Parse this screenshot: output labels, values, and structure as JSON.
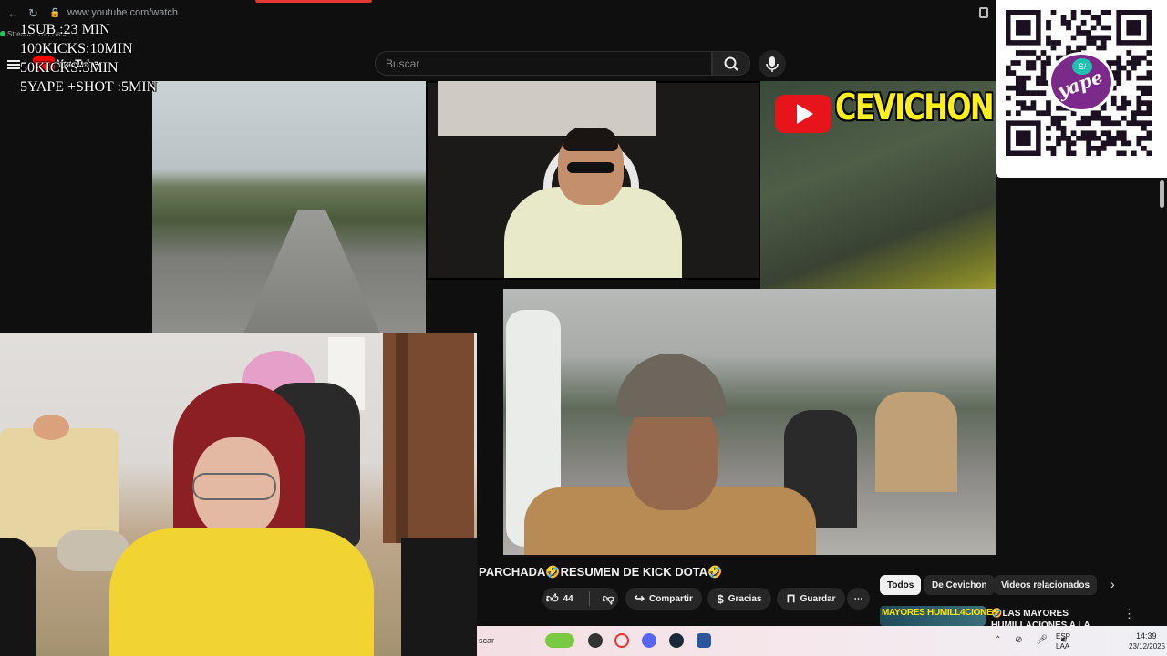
{
  "browser": {
    "url": "www.youtube.com/watch",
    "stream_label": "Stream · Turf Basi..."
  },
  "overlay": {
    "rules": [
      "1SUB :23 MIN",
      "100KICKS:10MIN",
      "50KICKS:3MIN",
      "5YAPE +SHOT :5MIN"
    ]
  },
  "header": {
    "logo_text": "YouTube",
    "search_placeholder": "Buscar"
  },
  "channel_banner": {
    "name": "CEVICHON"
  },
  "qr": {
    "brand": "yape",
    "currency_badge": "S/"
  },
  "video": {
    "title": "PARCHADA🤣RESUMEN DE KICK DOTA🤣",
    "likes": "44",
    "share_label": "Compartir",
    "thanks_label": "Gracias",
    "save_label": "Guardar"
  },
  "chips": [
    "Todos",
    "De Cevichon",
    "Videos relacionados"
  ],
  "recommended": {
    "thumb_text": "MAYORES HUMILL4CIONES",
    "title": "🤣LAS MAYORES HUMILLACIONES A LA FEKA"
  },
  "taskbar": {
    "search_text": "scar",
    "lang_line1": "ESP",
    "lang_line2": "LAA",
    "time": "14:39",
    "date": "23/12/2025"
  },
  "colors": {
    "yt_red": "#ff0000",
    "banner_yellow": "#ffef1a",
    "yape_purple": "#7b2a8a"
  }
}
